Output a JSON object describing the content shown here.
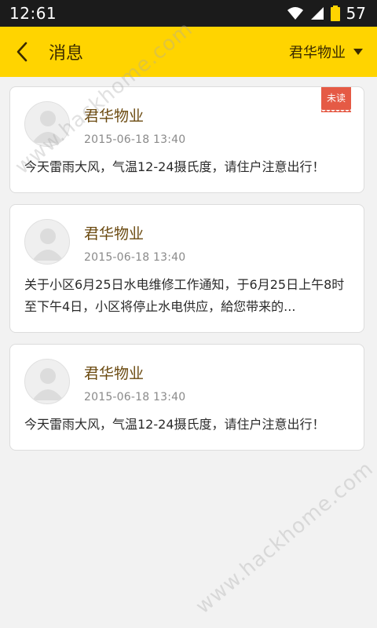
{
  "status_bar": {
    "time": "12:61",
    "battery": "57",
    "icons": [
      "wifi-icon",
      "signal-icon",
      "battery-icon"
    ]
  },
  "app_bar": {
    "back_icon": "chevron-left-icon",
    "title": "消息",
    "filter_label": "君华物业",
    "filter_icon": "caret-down-icon",
    "accent_color": "#ffd400"
  },
  "messages": [
    {
      "sender": "君华物业",
      "datetime": "2015-06-18  13:40",
      "text": "今天雷雨大风，气温12-24摄氏度，请住户注意出行！",
      "badge": "未读"
    },
    {
      "sender": "君华物业",
      "datetime": "2015-06-18  13:40",
      "text": "关于小区6月25日水电维修工作通知，于6月25日上午8时至下午4日，小区将停止水电供应，給您带来的...",
      "badge": ""
    },
    {
      "sender": "君华物业",
      "datetime": "2015-06-18  13:40",
      "text": "今天雷雨大风，气温12-24摄氏度，请住户注意出行！",
      "badge": ""
    }
  ],
  "watermark": "www.hackhome.com"
}
